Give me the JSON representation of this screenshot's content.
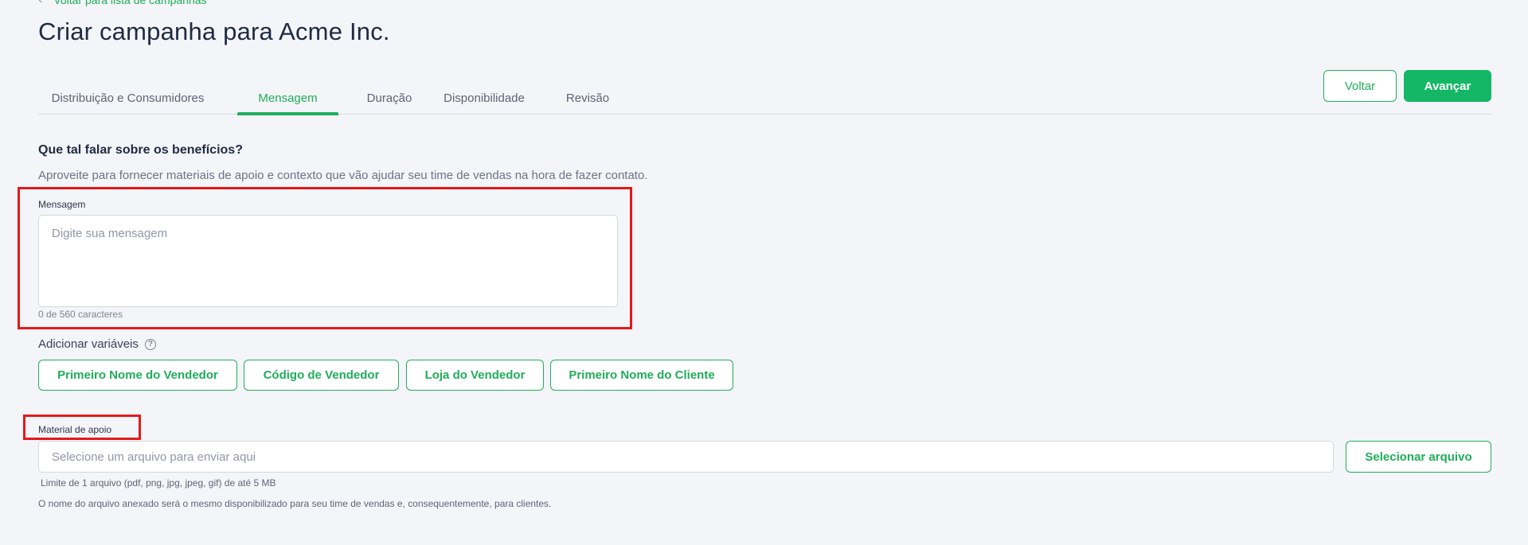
{
  "header": {
    "back_link": "Voltar para lista de campanhas",
    "title": "Criar campanha para Acme Inc."
  },
  "tabs": [
    {
      "label": "Distribuição e Consumidores",
      "active": false
    },
    {
      "label": "Mensagem",
      "active": true
    },
    {
      "label": "Duração",
      "active": false
    },
    {
      "label": "Disponibilidade",
      "active": false
    },
    {
      "label": "Revisão",
      "active": false
    }
  ],
  "actions": {
    "back_label": "Voltar",
    "next_label": "Avançar"
  },
  "section": {
    "title": "Que tal falar sobre os benefícios?",
    "description": "Aproveite para fornecer materiais de apoio e contexto que vão ajudar seu time de vendas na hora de fazer contato."
  },
  "message": {
    "label": "Mensagem",
    "placeholder": "Digite sua mensagem",
    "value": "",
    "char_count": "0 de 560 caracteres"
  },
  "variables": {
    "label": "Adicionar variáveis",
    "help_icon": "?",
    "items": [
      "Primeiro Nome do Vendedor",
      "Código de Vendedor",
      "Loja do Vendedor",
      "Primeiro Nome do Cliente"
    ]
  },
  "support_material": {
    "label": "Material de apoio",
    "placeholder": "Selecione um arquivo para enviar aqui",
    "select_label": "Selecionar arquivo",
    "limit_hint": "Limite de 1 arquivo (pdf, png, jpg, jpeg, gif) de até 5 MB",
    "name_hint": "O nome do arquivo anexado será o mesmo disponibilizado para seu time de vendas e, consequentemente, para clientes."
  },
  "colors": {
    "accent": "#13b765",
    "highlight": "#e3191b",
    "background": "#f4f5f8"
  }
}
